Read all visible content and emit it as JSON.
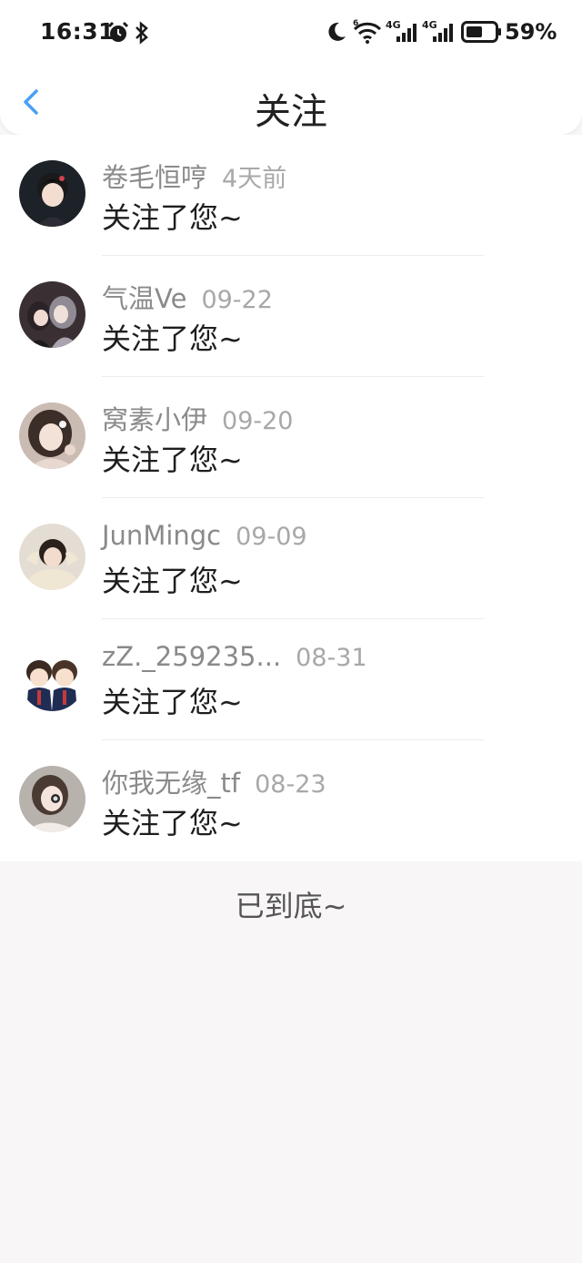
{
  "status_bar": {
    "time": "16:31",
    "battery": "59%",
    "icons": [
      "alarm-icon",
      "bluetooth-icon",
      "moon-icon",
      "wifi-icon",
      "signal-4g-icon",
      "signal-4g-icon",
      "battery-icon"
    ],
    "signal_label_1": "4G",
    "signal_label_2": "4G",
    "wifi_label": "6"
  },
  "header": {
    "title": "关注",
    "back_icon": "chevron-left-icon",
    "accent_color": "#4a9ff5"
  },
  "notifications": [
    {
      "username": "卷毛恒哼",
      "time": "4天前",
      "message": "关注了您~"
    },
    {
      "username": "气温Ve",
      "time": "09-22",
      "message": "关注了您~"
    },
    {
      "username": "窝素小伊",
      "time": "09-20",
      "message": "关注了您~"
    },
    {
      "username": "JunMingc",
      "time": "09-09",
      "message": "关注了您~"
    },
    {
      "username": "zZ._259235...",
      "time": "08-31",
      "message": "关注了您~"
    },
    {
      "username": "你我无缘_tf",
      "time": "08-23",
      "message": "关注了您~"
    }
  ],
  "footer": {
    "end_text": "已到底~"
  }
}
